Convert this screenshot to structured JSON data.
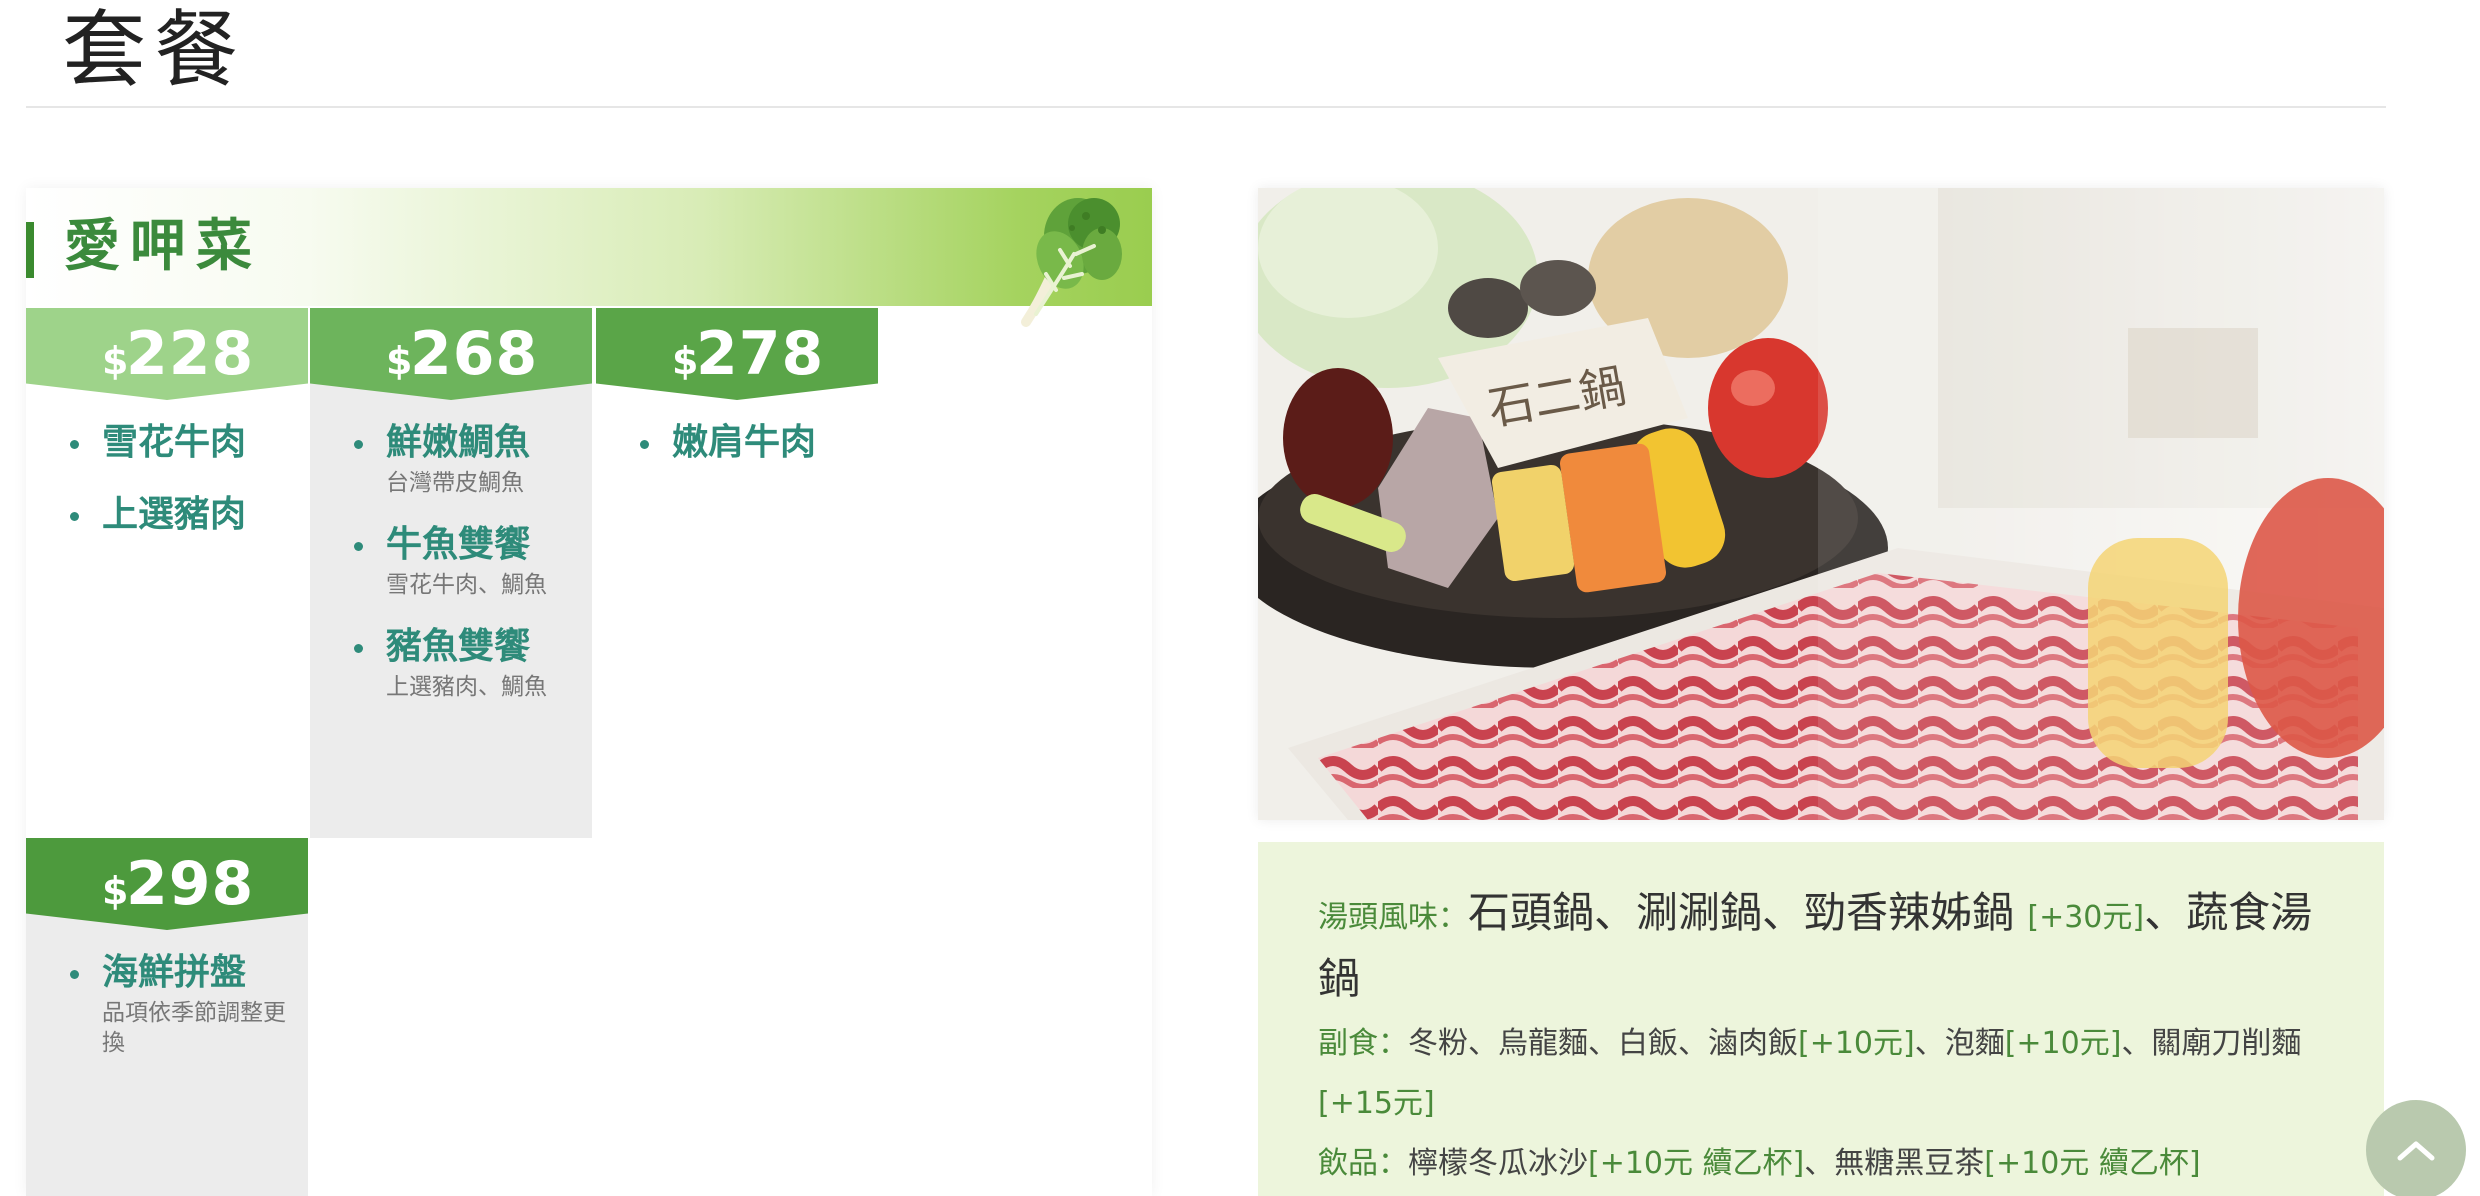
{
  "page": {
    "title": "套餐"
  },
  "menu": {
    "section_title": "愛呷菜",
    "columns": [
      {
        "currency": "$",
        "price": "228",
        "items": [
          {
            "name": "雪花牛肉",
            "sub": ""
          },
          {
            "name": "上選豬肉",
            "sub": ""
          }
        ]
      },
      {
        "currency": "$",
        "price": "268",
        "items": [
          {
            "name": "鮮嫩鯛魚",
            "sub": "台灣帶皮鯛魚"
          },
          {
            "name": "牛魚雙饗",
            "sub": "雪花牛肉、鯛魚"
          },
          {
            "name": "豬魚雙饗",
            "sub": "上選豬肉、鯛魚"
          }
        ]
      },
      {
        "currency": "$",
        "price": "278",
        "items": [
          {
            "name": "嫩肩牛肉",
            "sub": ""
          }
        ]
      },
      {
        "currency": "$",
        "price": "298",
        "items": [
          {
            "name": "海鮮拼盤",
            "sub": "品項依季節調整更換"
          }
        ]
      }
    ]
  },
  "photo": {
    "logo_text": "石二鍋"
  },
  "info": {
    "soup_label": "湯頭風味：",
    "soup_part1": "石頭鍋、涮涮鍋、勁香辣姊鍋 ",
    "soup_extra": "[+30元]",
    "soup_part2": "、蔬食湯鍋",
    "side_label": "副食：",
    "side_a": "冬粉、烏龍麵、白飯、滷肉飯",
    "side_a_extra": "[+10元]",
    "side_b": "、泡麵",
    "side_b_extra": "[+10元]",
    "side_c": "、關廟刀削麵",
    "side_c_extra": "[+15元]",
    "drink_label": "飲品：",
    "drink_a": "檸檬冬瓜冰沙",
    "drink_a_extra": "[+10元 續乙杯]",
    "drink_b": "、無糖黑豆茶",
    "drink_b_extra": "[+10元 續乙杯]"
  },
  "colors": {
    "accent_green": "#3b8a3c",
    "item_teal": "#2e8b7a",
    "info_bg": "#edf5dc"
  },
  "icons": {
    "banner": "lettuce-icon",
    "scroll": "chevron-up-icon"
  }
}
